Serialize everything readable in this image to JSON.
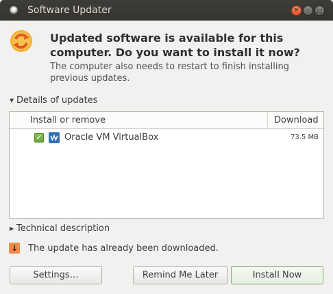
{
  "window": {
    "title": "Software Updater"
  },
  "header": {
    "headline": "Updated software is available for this computer. Do you want to install it now?",
    "subtext": "The computer also needs to restart to finish installing previous updates."
  },
  "details": {
    "expander_label": "Details of updates",
    "columns": {
      "install": "Install or remove",
      "download": "Download"
    },
    "rows": [
      {
        "name": "Oracle VM VirtualBox",
        "size": "73.5 MB",
        "checked": true
      }
    ]
  },
  "technical": {
    "expander_label": "Technical description"
  },
  "status": {
    "message": "The update has already been downloaded."
  },
  "buttons": {
    "settings": "Settings…",
    "remind": "Remind Me Later",
    "install": "Install Now"
  },
  "colors": {
    "accent_orange": "#f08a4b",
    "check_green": "#6aa53a",
    "titlebar": "#3d3c38"
  }
}
